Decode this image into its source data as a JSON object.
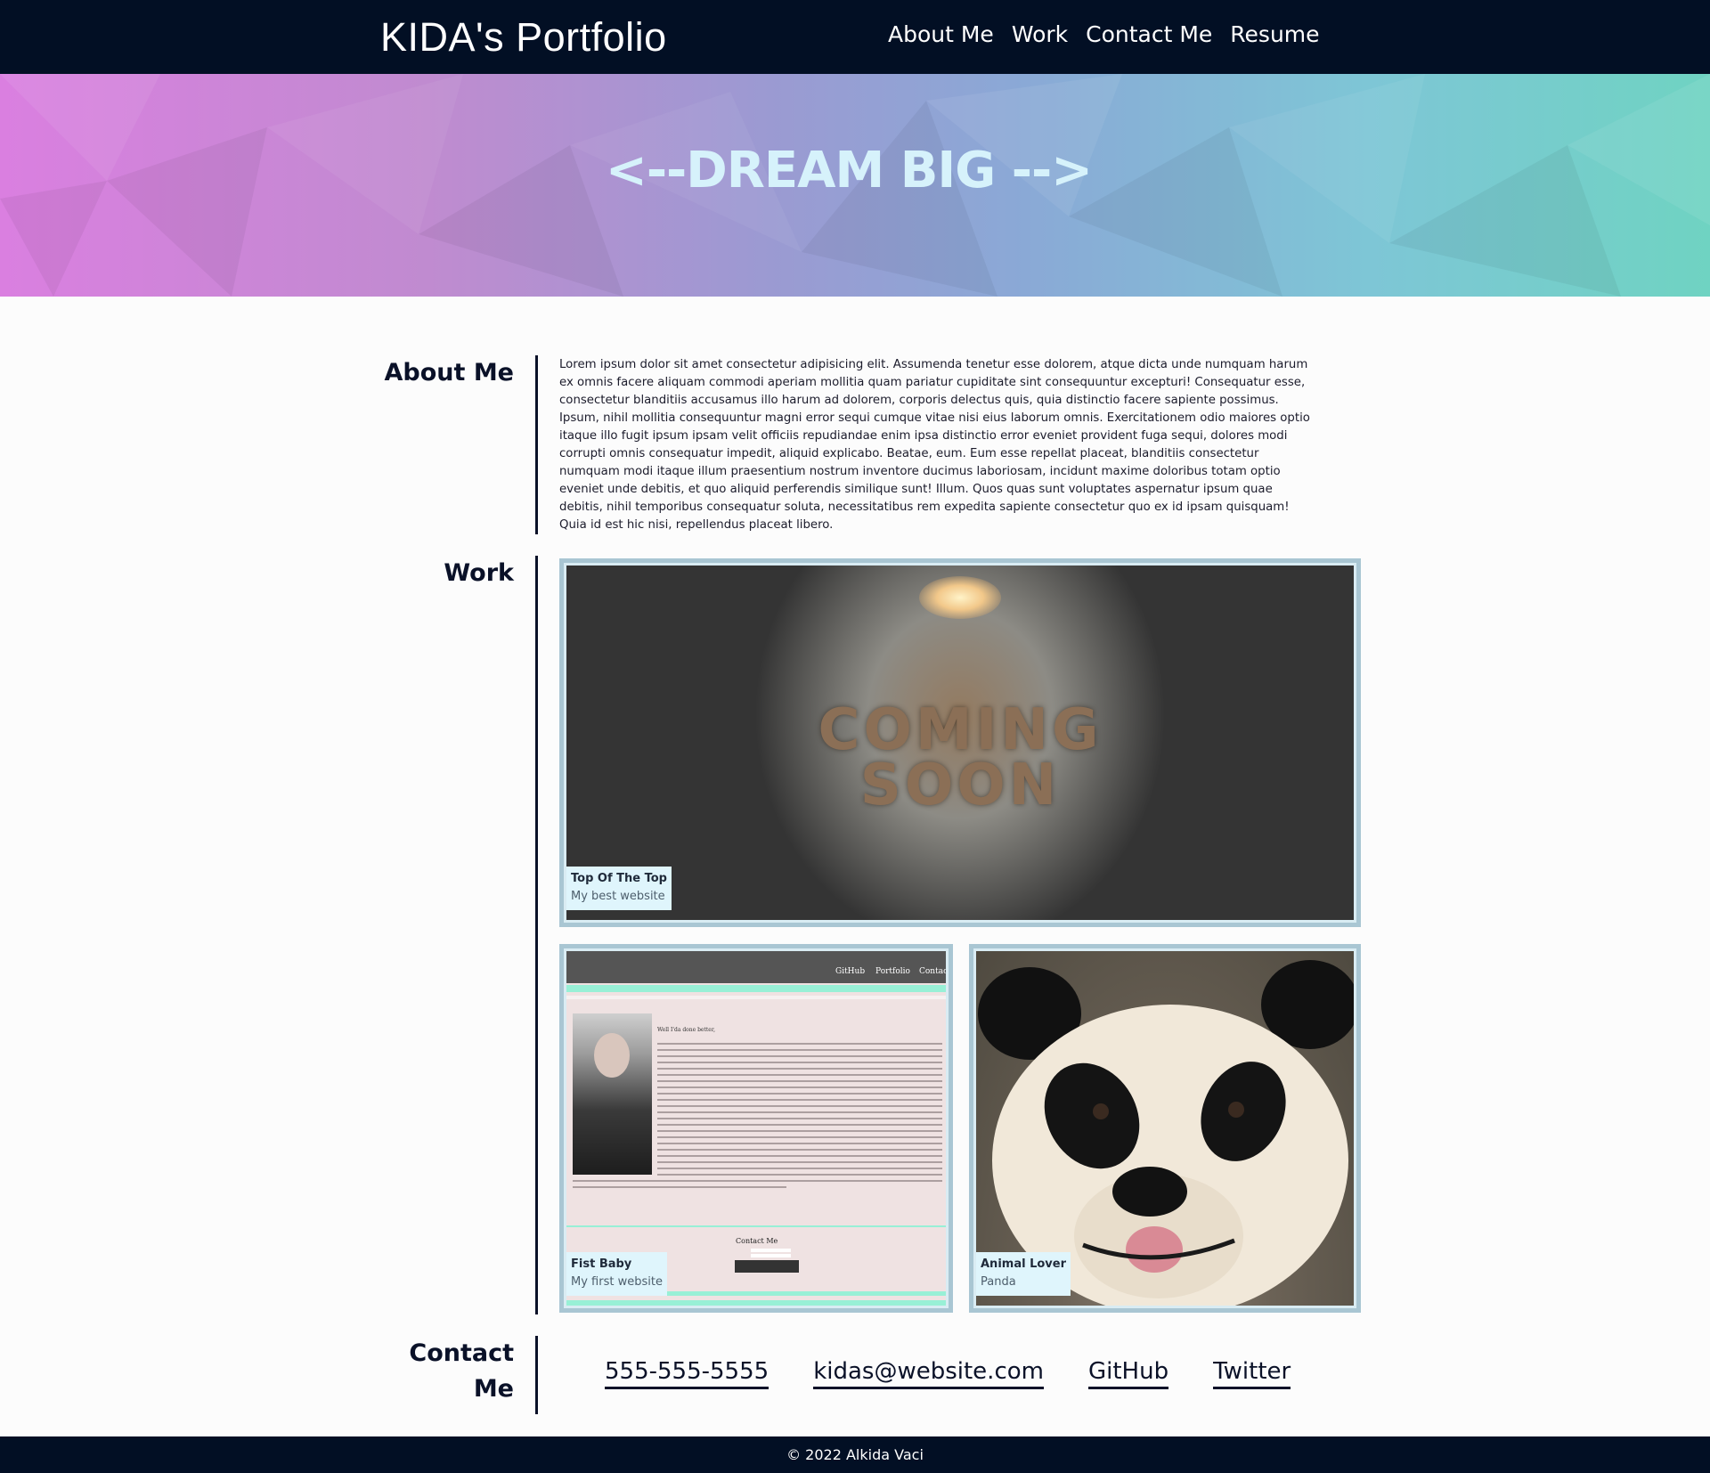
{
  "header": {
    "brand": "KIDA's Portfolio",
    "nav": [
      "About Me",
      "Work",
      "Contact Me",
      "Resume"
    ]
  },
  "hero": {
    "title": "<--DREAM BIG -->"
  },
  "about": {
    "title": "About Me",
    "text": "Lorem ipsum dolor sit amet consectetur adipisicing elit. Assumenda tenetur esse dolorem, atque dicta unde numquam harum ex omnis facere aliquam commodi aperiam mollitia quam pariatur cupiditate sint consequuntur excepturi! Consequatur esse, consectetur blanditiis accusamus illo harum ad dolorem, corporis delectus quis, quia distinctio facere sapiente possimus. Ipsum, nihil mollitia consequuntur magni error sequi cumque vitae nisi eius laborum omnis. Exercitationem odio maiores optio itaque illo fugit ipsum ipsam velit officiis repudiandae enim ipsa distinctio error eveniet provident fuga sequi, dolores modi corrupti omnis consequatur impedit, aliquid explicabo. Beatae, eum. Eum esse repellat placeat, blanditiis consectetur numquam modi itaque illum praesentium nostrum inventore ducimus laboriosam, incidunt maxime doloribus totam optio eveniet unde debitis, et quo aliquid perferendis similique sunt! Illum. Quos quas sunt voluptates aspernatur ipsum quae debitis, nihil temporibus consequatur soluta, necessitatibus rem expedita sapiente consectetur quo ex id ipsam quisquam! Quia id est hic nisi, repellendus placeat libero."
  },
  "work": {
    "title": "Work",
    "projects": [
      {
        "title": "Top Of The Top",
        "subtitle": "My best website",
        "image_text": [
          "COMING",
          "SOON"
        ]
      },
      {
        "title": "Fist Baby",
        "subtitle": "My first website",
        "image_nav": [
          "GitHub",
          "Portfolio",
          "Contact"
        ],
        "image_greeting": "Well I'da done better,",
        "image_contact_title": "Contact Me"
      },
      {
        "title": "Animal Lover",
        "subtitle": "Panda"
      }
    ]
  },
  "contact": {
    "title_line1": "Contact",
    "title_line2": "Me",
    "links": [
      "555-555-5555",
      "kidas@website.com",
      "GitHub",
      "Twitter"
    ]
  },
  "footer": {
    "text": "© 2022 Alkida Vaci"
  }
}
